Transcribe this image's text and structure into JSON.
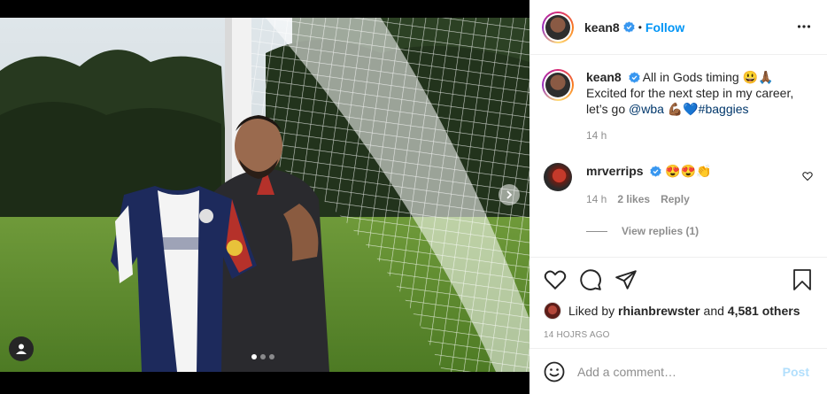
{
  "post": {
    "author": "kean8",
    "follow_separator": "•",
    "follow_label": "Follow",
    "more_icon": "more-horizontal-icon"
  },
  "caption": {
    "username": "kean8",
    "line1": "All in Gods timing 😃🙏🏾",
    "line2": "Excited for the next step in my career,",
    "line3_prefix": "let’s go ",
    "mention": "@wba",
    "emojis": " 💪🏾💙",
    "hashtag": "#baggies",
    "time": "14 h"
  },
  "comments": [
    {
      "username": "mrverrips",
      "text": "😍😍👏",
      "time": "14 h",
      "likes": "2 likes",
      "reply_label": "Reply"
    }
  ],
  "view_replies": "View replies (1)",
  "likes_line": {
    "prefix": "Liked by ",
    "user": "rhianbrewster",
    "joiner": " and ",
    "others": "4,581 others"
  },
  "timestamp": "14 HOJRS AGO",
  "composer": {
    "placeholder": "Add a comment…",
    "post_label": "Post"
  },
  "carousel": {
    "slides": 3,
    "active_index": 0
  },
  "colors": {
    "accent_blue": "#0095f6",
    "post_disabled": "#b2dffc",
    "verified": "#3897f0"
  }
}
